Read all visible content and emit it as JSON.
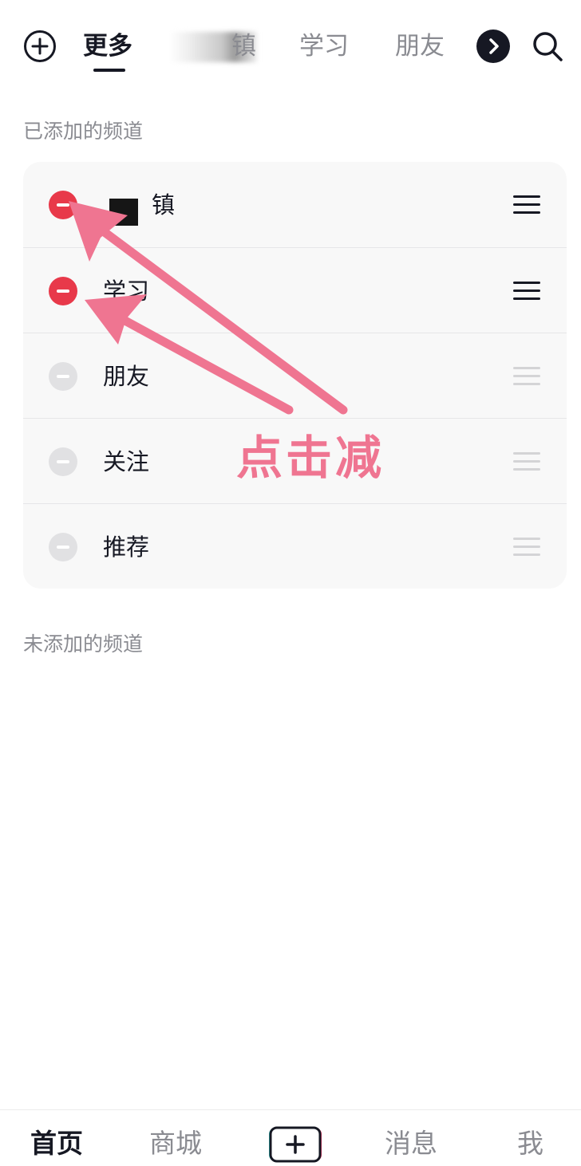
{
  "top_tabs": {
    "more": "更多",
    "town_suffix": "镇",
    "study": "学习",
    "friends": "朋友"
  },
  "sections": {
    "added_title": "已添加的频道",
    "not_added_title": "未添加的频道"
  },
  "channels": [
    {
      "label": "镇",
      "removable": true
    },
    {
      "label": "学习",
      "removable": true
    },
    {
      "label": "朋友",
      "removable": false
    },
    {
      "label": "关注",
      "removable": false
    },
    {
      "label": "推荐",
      "removable": false
    }
  ],
  "annotation": {
    "label": "点击减",
    "color": "#ef7591"
  },
  "bottom_nav": {
    "home": "首页",
    "mall": "商城",
    "messages": "消息",
    "me": "我"
  },
  "colors": {
    "remove_active": "#e8394a",
    "remove_disabled": "#e1e1e3",
    "text_primary": "#161823",
    "text_secondary": "#8a8b91",
    "card_bg": "#f8f8f8"
  },
  "icons": {
    "add": "add-channel-icon",
    "more_arrow": "chevron-right-icon",
    "search": "search-icon",
    "remove": "minus-circle-icon",
    "drag": "drag-handle-icon",
    "publish": "plus-icon"
  }
}
